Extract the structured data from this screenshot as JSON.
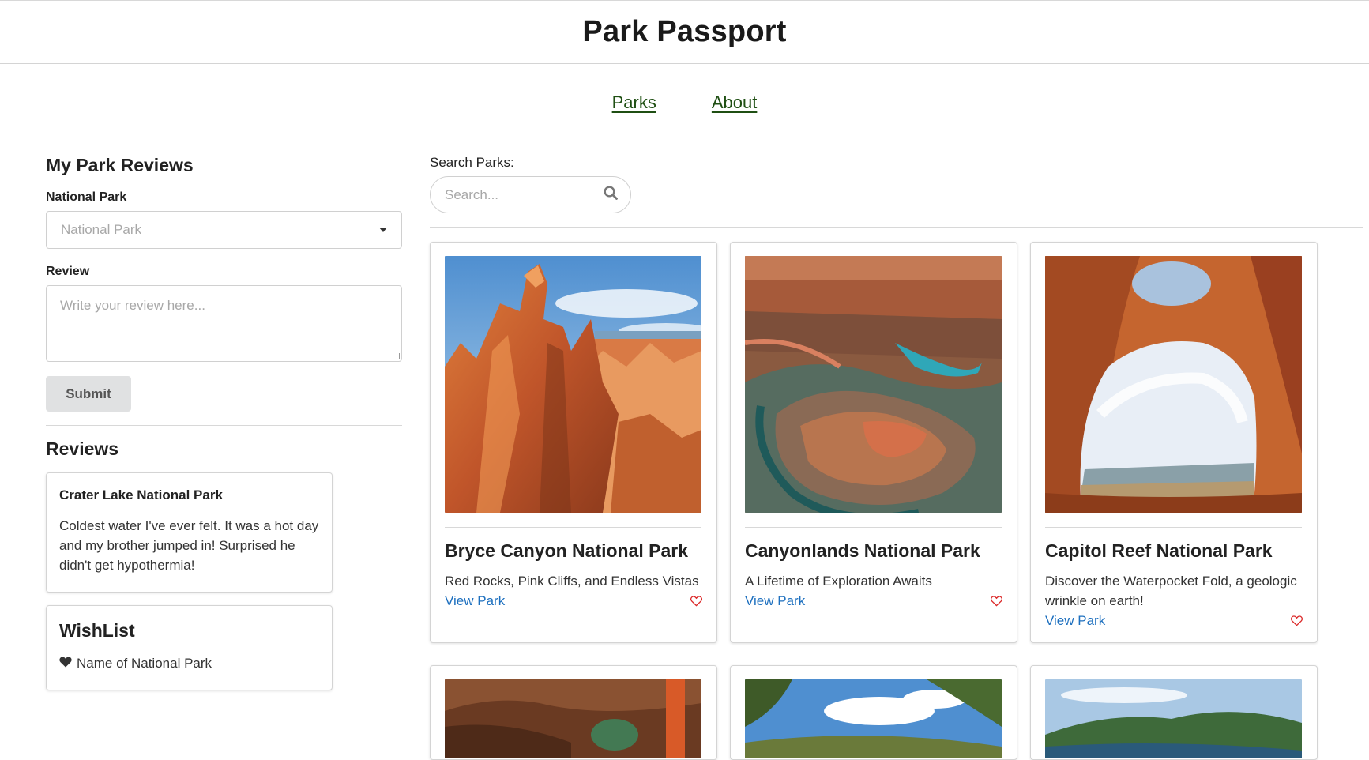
{
  "header": {
    "title": "Park Passport"
  },
  "nav": {
    "parks": "Parks",
    "about": "About"
  },
  "sidebar": {
    "title": "My Park Reviews",
    "park_label": "National Park",
    "park_placeholder": "National Park",
    "review_label": "Review",
    "review_placeholder": "Write your review here...",
    "submit_label": "Submit",
    "reviews_title": "Reviews",
    "reviews": [
      {
        "park": "Crater Lake National Park",
        "text": "Coldest water I've ever felt. It was a hot day and my brother jumped in! Surprised he didn't get hypothermia!"
      }
    ],
    "wishlist": {
      "title": "WishList",
      "item": "Name of National Park"
    }
  },
  "search": {
    "label": "Search Parks:",
    "placeholder": "Search..."
  },
  "parks": [
    {
      "name": "Bryce Canyon National Park",
      "tagline": "Red Rocks, Pink Cliffs, and Endless Vistas",
      "link": "View Park"
    },
    {
      "name": "Canyonlands National Park",
      "tagline": "A Lifetime of Exploration Awaits",
      "link": "View Park"
    },
    {
      "name": "Capitol Reef National Park",
      "tagline": "Discover the Waterpocket Fold, a geologic wrinkle on earth!",
      "link": "View Park"
    }
  ],
  "colors": {
    "nav_link": "#1f4f13",
    "view_link": "#1e70bf",
    "heart": "#db2828",
    "submit_bg": "#e0e1e2"
  },
  "icons": {
    "search": "search-icon",
    "heart": "heart-outline-icon",
    "wishlist_heart": "heart-filled-icon",
    "caret": "dropdown-caret-icon"
  }
}
